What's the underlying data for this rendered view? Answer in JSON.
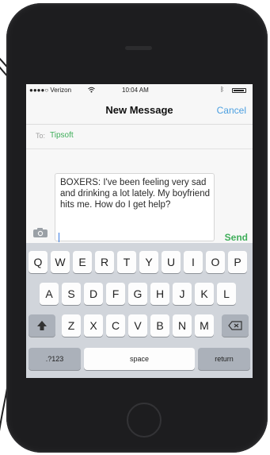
{
  "status_bar": {
    "carrier": "●●●●○ Verizon",
    "time": "10:04 AM"
  },
  "nav": {
    "title": "New Message",
    "cancel_label": "Cancel"
  },
  "recipient": {
    "label": "To:",
    "name": "Tipsoft"
  },
  "message": {
    "text": "BOXERS: I've been feeling very sad and drinking a lot lately. My boyfriend hits me. How do I get help?"
  },
  "send_label": "Send",
  "keyboard": {
    "row1": [
      "Q",
      "W",
      "E",
      "R",
      "T",
      "Y",
      "U",
      "I",
      "O",
      "P"
    ],
    "row2": [
      "A",
      "S",
      "D",
      "F",
      "G",
      "H",
      "J",
      "K",
      "L"
    ],
    "row3": [
      "Z",
      "X",
      "C",
      "V",
      "B",
      "N",
      "M"
    ],
    "numbers_label": ".?123",
    "space_label": "space",
    "return_label": "return"
  },
  "icons": [
    "camera-icon",
    "shift-icon",
    "delete-icon",
    "wifi-icon",
    "bluetooth-icon",
    "battery-icon"
  ]
}
